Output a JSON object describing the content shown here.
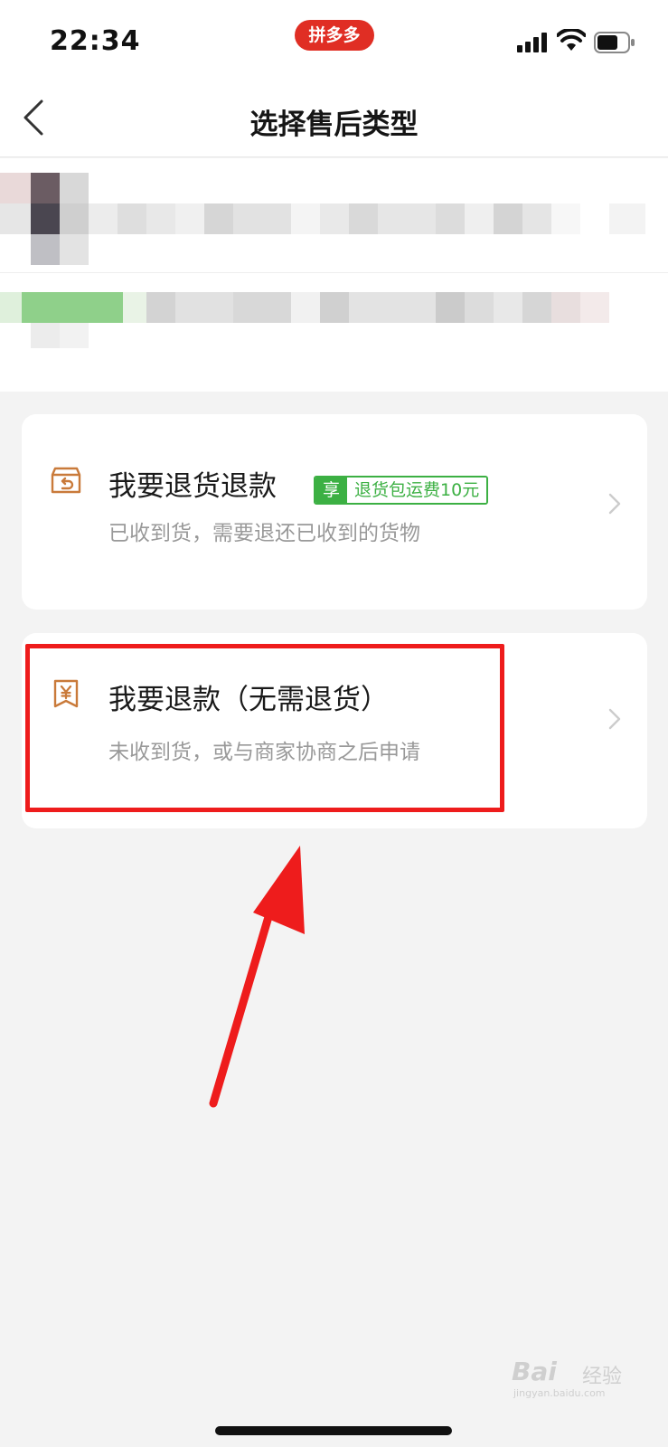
{
  "status_bar": {
    "time": "22:34",
    "app_badge": "拼多多",
    "icons": [
      "signal-icon",
      "wifi-icon",
      "battery-icon"
    ]
  },
  "nav": {
    "title": "选择售后类型",
    "back_icon": "chevron-left-icon"
  },
  "options": [
    {
      "title": "我要退货退款",
      "description": "已收到货，需要退还已收到的货物",
      "tag_enjoy": "享",
      "tag_text": "退货包运费10元",
      "icon": "return-package-icon"
    },
    {
      "title": "我要退款（无需退货）",
      "description": "未收到货，或与商家协商之后申请",
      "icon": "refund-yen-icon"
    }
  ],
  "watermark": {
    "brand": "Bai",
    "brand_suffix": "经验",
    "url": "jingyan.baidu.com"
  },
  "colors": {
    "brand_red": "#e02e24",
    "tag_green": "#3cb043",
    "icon_orange": "#c97a3a",
    "highlight_red": "#ee1c1c"
  }
}
